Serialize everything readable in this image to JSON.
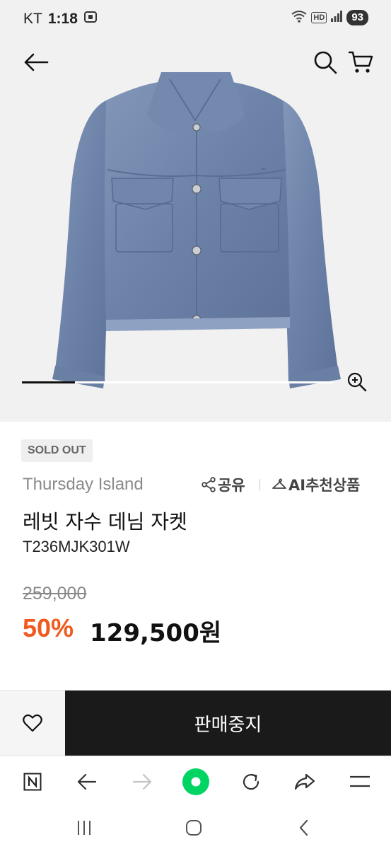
{
  "status_bar": {
    "carrier": "KT",
    "time": "1:18",
    "network_badge": "HD",
    "battery": "93"
  },
  "gallery": {
    "image_position": 0.17,
    "icons": {
      "back": "arrow-left-icon",
      "search": "search-icon",
      "cart": "cart-icon",
      "zoom": "zoom-in-icon"
    }
  },
  "product": {
    "status_badge": "SOLD OUT",
    "brand": "Thursday Island",
    "share_label": "공유",
    "ai_recommend_label": "AI추천상품",
    "name": "레빗 자수 데님 자켓",
    "code": "T236MJK301W",
    "original_price": "259,000",
    "discount": "50%",
    "sale_price": "129,500원"
  },
  "purchase_bar": {
    "wish_icon": "heart-icon",
    "primary_label": "판매중지"
  },
  "browser_toolbar": {
    "icons": [
      "n-logo-icon",
      "back-arrow-icon",
      "forward-arrow-icon",
      "home-dot-icon",
      "refresh-icon",
      "share-arrow-icon",
      "menu-icon"
    ]
  },
  "system_nav": {
    "icons": [
      "recent-apps-icon",
      "home-icon",
      "back-icon"
    ]
  },
  "colors": {
    "accent_discount": "#f05a1e",
    "primary_button": "#1a1a1a",
    "home_dot": "#00d463",
    "denim": "#6f86ad"
  }
}
